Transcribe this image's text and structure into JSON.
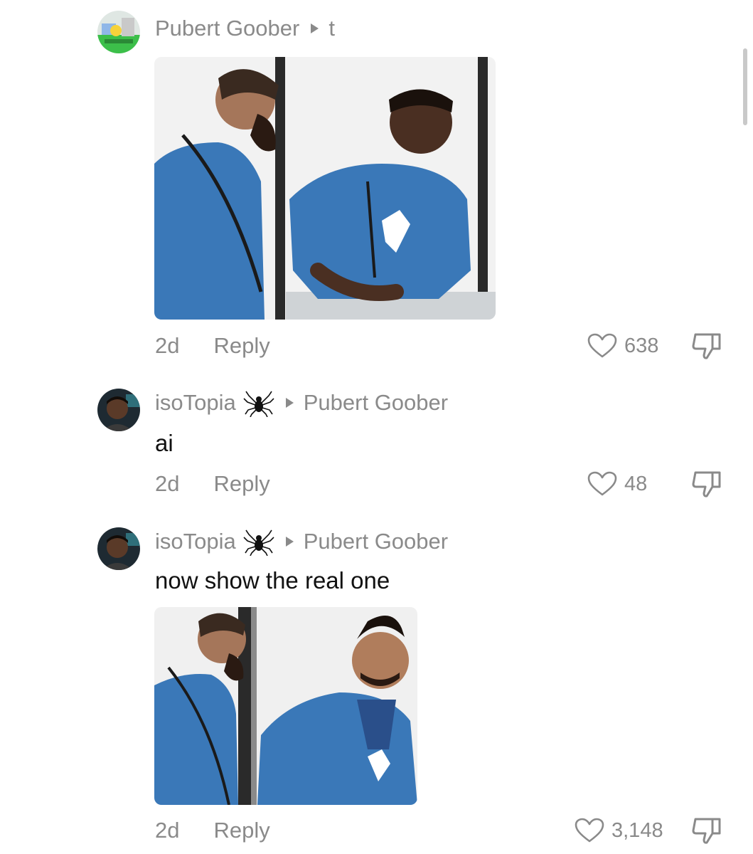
{
  "comments": [
    {
      "author": "Pubert Goober",
      "reply_to": "t",
      "text": "",
      "time": "2d",
      "reply_label": "Reply",
      "likes": "638",
      "avatar_icon": "pokemon-avatar-icon",
      "has_media": true
    },
    {
      "author": "isoTopia",
      "reply_to": "Pubert Goober",
      "text": "ai",
      "time": "2d",
      "reply_label": "Reply",
      "likes": "48",
      "avatar_icon": "portrait-avatar-icon",
      "has_media": false
    },
    {
      "author": "isoTopia",
      "reply_to": "Pubert Goober",
      "text": "now show the real one",
      "time": "2d",
      "reply_label": "Reply",
      "likes": "3,148",
      "avatar_icon": "portrait-avatar-icon",
      "has_media": true
    }
  ],
  "icons": {
    "like": "heart-outline-icon",
    "dislike": "thumbs-down-icon",
    "badge": "spider-icon",
    "reply_arrow": "triangle-right-icon"
  },
  "colors": {
    "muted_text": "#8a8a8a",
    "body_text": "#111111",
    "shirt_blue": "#3a78b8"
  }
}
